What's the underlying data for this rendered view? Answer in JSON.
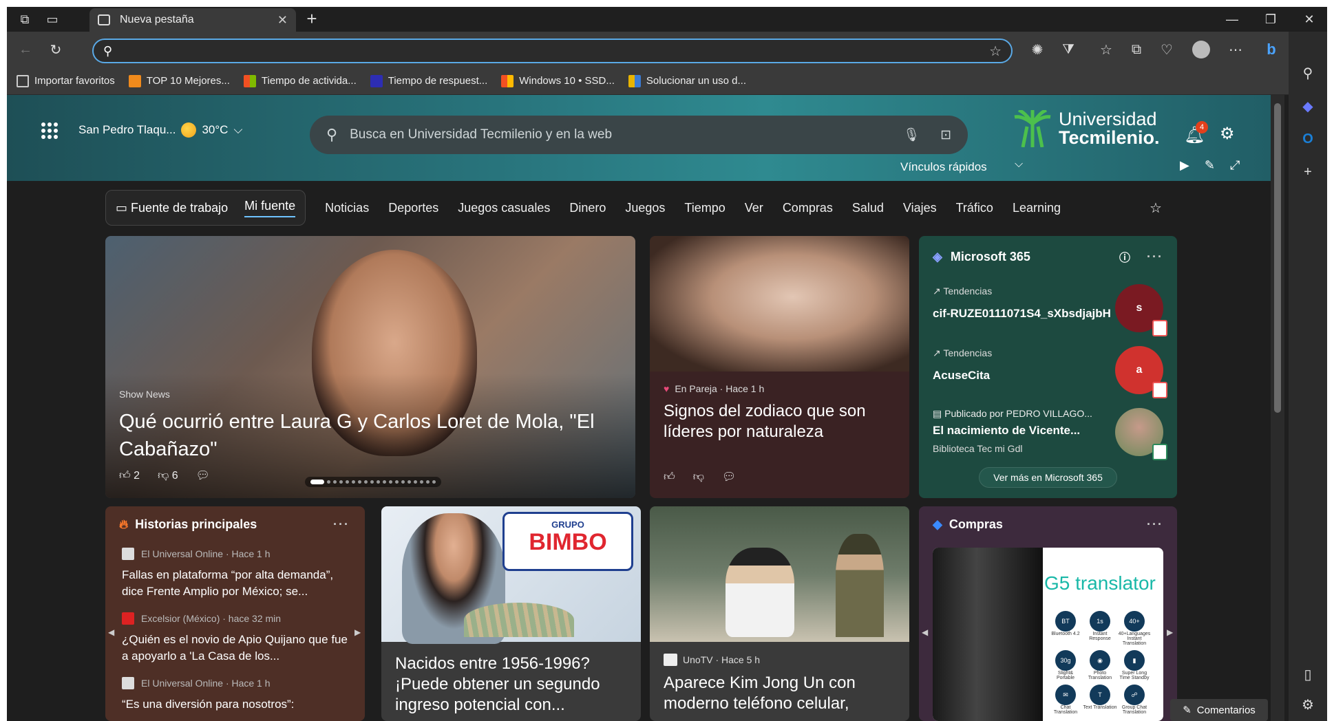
{
  "tab": {
    "title": "Nueva pestaña"
  },
  "address": {
    "value": "",
    "placeholder": ""
  },
  "favorites": [
    {
      "label": "Importar favoritos",
      "color": "#cccccc"
    },
    {
      "label": "TOP 10 Mejores...",
      "color": "#f08a1c"
    },
    {
      "label": "Tiempo de activida...",
      "color": "#f25022"
    },
    {
      "label": "Tiempo de respuest...",
      "color": "#2d2db3"
    },
    {
      "label": "Windows 10 • SSD...",
      "color": "#f25022"
    },
    {
      "label": "Solucionar un uso d...",
      "color": "#e8b400"
    }
  ],
  "hero": {
    "location": "San Pedro Tlaqu...",
    "temperature": "30°C",
    "search_placeholder": "Busca en Universidad Tecmilenio y en la web",
    "logo_line1": "Universidad",
    "logo_line2": "Tecmilenio.",
    "notifications": "4",
    "quick_links": "Vínculos rápidos"
  },
  "nav": {
    "work_feed": "Fuente de trabajo",
    "my_feed": "Mi fuente",
    "items": [
      "Noticias",
      "Deportes",
      "Juegos casuales",
      "Dinero",
      "Juegos",
      "Tiempo",
      "Ver",
      "Compras",
      "Salud",
      "Viajes",
      "Tráfico",
      "Learning"
    ]
  },
  "featured": {
    "source": "Show News",
    "title": "Qué ocurrió entre Laura G y Carlos Loret de Mola, \"El Cabañazo\"",
    "likes": "2",
    "dislikes": "6"
  },
  "zodiac": {
    "source": "En Pareja · Hace 1 h",
    "title": "Signos del zodiaco que son líderes por naturaleza"
  },
  "m365": {
    "title": "Microsoft 365",
    "items": [
      {
        "tag": "Tendencias",
        "name": "cif-RUZE0111071S4_sXbsdjajbH",
        "avatar": "s"
      },
      {
        "tag": "Tendencias",
        "name": "AcuseCita",
        "avatar": "a"
      },
      {
        "tag": "Publicado por PEDRO VILLAGO...",
        "name": "El nacimiento de Vicente...",
        "sub": "Biblioteca Tec mi Gdl"
      }
    ],
    "more": "Ver más en Microsoft 365"
  },
  "top_stories": {
    "title": "Historias principales",
    "items": [
      {
        "source": "El Universal Online · Hace 1 h",
        "title": "Fallas en plataforma “por alta demanda”, dice Frente Amplio por México; se..."
      },
      {
        "source": "Excelsior (México) · hace 32 min",
        "title": "¿Quién es el novio de Apio Quijano que fue a apoyarlo a 'La Casa de los..."
      },
      {
        "source": "El Universal Online · Hace 1 h",
        "title": "“Es una diversión para nosotros”:"
      }
    ]
  },
  "bimbo": {
    "brand_top": "GRUPO",
    "brand": "BIMBO",
    "title": "Nacidos entre 1956-1996? ¡Puede obtener un segundo ingreso potencial con..."
  },
  "kim": {
    "source": "UnoTV · Hace 5 h",
    "title": "Aparece Kim Jong Un con moderno teléfono celular,"
  },
  "shopping": {
    "title": "Compras",
    "product": "G5 translator",
    "features": [
      "Bluetooth 4.2",
      "Instant Response",
      "40+Languages Instant Translation",
      "Slight& Portable",
      "Photo Translation",
      "Super Long Time Standby",
      "Chat Translation",
      "Text Translation",
      "Group Chat Translation"
    ],
    "feature_marks": [
      "BT",
      "1s",
      "40+",
      "30g",
      "◉",
      "▮",
      "✉",
      "T",
      "☍"
    ]
  },
  "feedback": "Comentarios"
}
